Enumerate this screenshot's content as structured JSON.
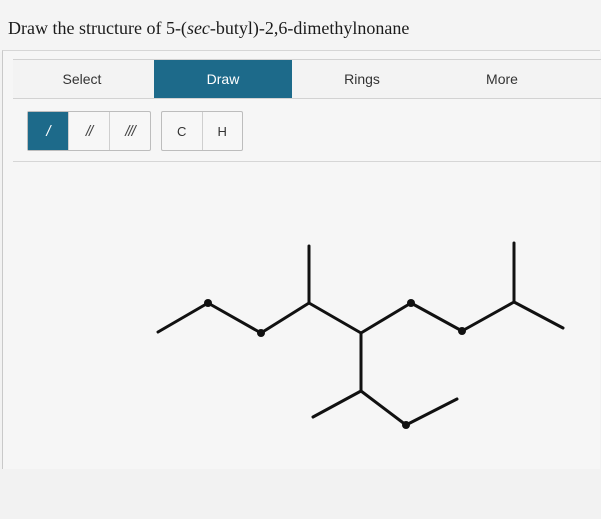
{
  "question": {
    "prefix": "Draw the structure of 5-(",
    "italic": "sec",
    "suffix": "-butyl)-2,6-dimethylnonane"
  },
  "tabs": [
    {
      "label": "Select",
      "active": false
    },
    {
      "label": "Draw",
      "active": true
    },
    {
      "label": "Rings",
      "active": false
    },
    {
      "label": "More",
      "active": false
    }
  ],
  "bond_tools": [
    {
      "label": "/",
      "name": "single-bond",
      "active": true
    },
    {
      "label": "//",
      "name": "double-bond",
      "active": false
    },
    {
      "label": "///",
      "name": "triple-bond",
      "active": false
    }
  ],
  "atom_tools": [
    {
      "label": "C"
    },
    {
      "label": "H"
    }
  ],
  "colors": {
    "accent": "#1d6a8a",
    "bond": "#111111"
  }
}
